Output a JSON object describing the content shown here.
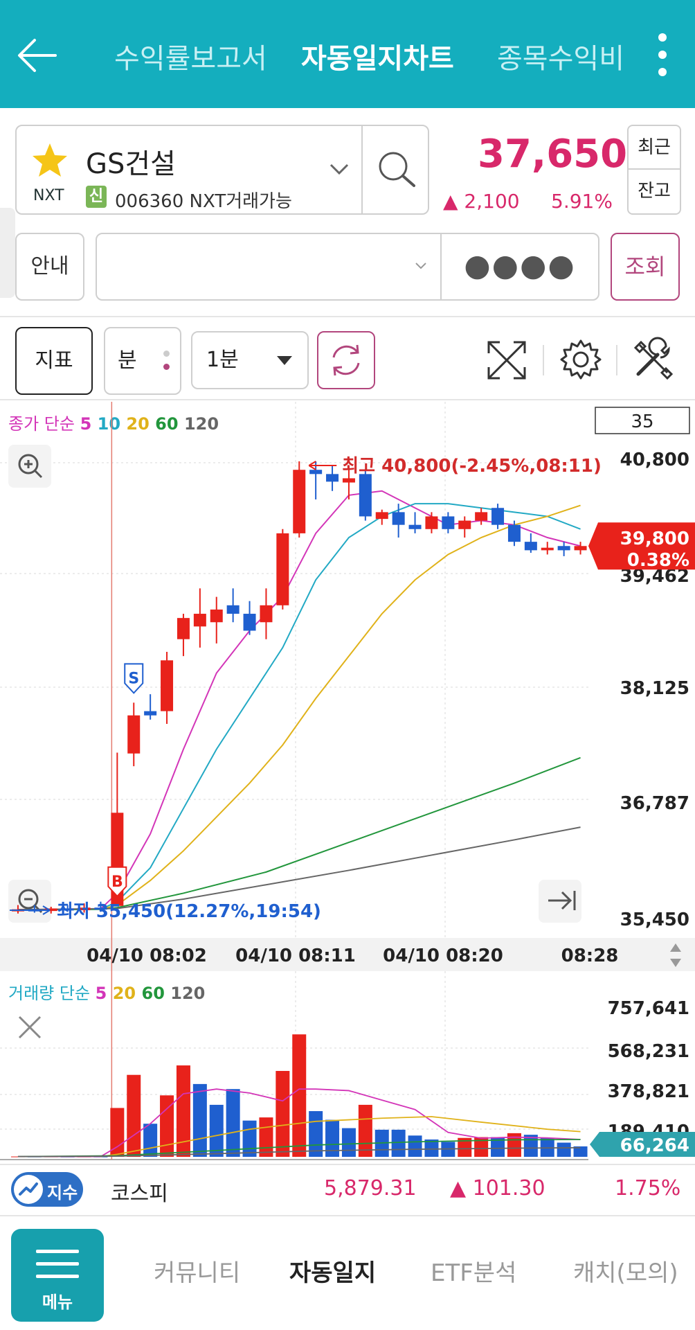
{
  "header": {
    "tabs": [
      {
        "label": "수익률보고서",
        "active": false
      },
      {
        "label": "자동일지차트",
        "active": true
      },
      {
        "label": "종목수익비"
      }
    ]
  },
  "stock": {
    "market": "NXT",
    "name": "GS건설",
    "credit_badge": "신",
    "code_info": "006360 NXT거래가능",
    "price": "37,650",
    "change": "▲ 2,100",
    "rate": "5.91%",
    "side_buttons": [
      "최근",
      "잔고"
    ]
  },
  "account": {
    "info_label": "안내",
    "password_mask": "●●●●",
    "query_label": "조회"
  },
  "toolbar": {
    "indicator_label": "지표",
    "period_label": "분",
    "interval_value": "1분"
  },
  "colors": {
    "accent": "#14aebe",
    "up": "#e8221b",
    "down": "#1f5fcf",
    "ma5": "#d335b8",
    "ma10": "#22a9c4",
    "ma20": "#e0b21a",
    "ma60": "#22963c",
    "ma120": "#666666"
  },
  "chart_data": [
    {
      "type": "candlestick",
      "legend": {
        "prefix": "종가 단순",
        "periods": [
          "5",
          "10",
          "20",
          "60",
          "120"
        ]
      },
      "count_box": "35",
      "y_ticks": [
        "40,800",
        "39,462",
        "38,125",
        "36,787",
        "35,450"
      ],
      "ylim": [
        35450,
        40800
      ],
      "x_ticks": [
        "04/10 08:02",
        "04/10 08:11",
        "04/10 08:20",
        "08:28"
      ],
      "high_label": "최고 40,800(-2.45%,08:11)",
      "low_label": "최저 35,450(12.27%,19:54)",
      "current_price": "39,800",
      "current_rate": "0.38%",
      "markers": [
        {
          "label": "B",
          "index": 6
        },
        {
          "label": "S",
          "index": 7
        }
      ],
      "candles": [
        {
          "o": 35500,
          "h": 35560,
          "l": 35460,
          "c": 35510
        },
        {
          "o": 35510,
          "h": 35560,
          "l": 35470,
          "c": 35490
        },
        {
          "o": 35490,
          "h": 35540,
          "l": 35460,
          "c": 35520
        },
        {
          "o": 35520,
          "h": 35560,
          "l": 35480,
          "c": 35500
        },
        {
          "o": 35500,
          "h": 35580,
          "l": 35470,
          "c": 35530
        },
        {
          "o": 35530,
          "h": 35600,
          "l": 35480,
          "c": 35520
        },
        {
          "o": 35550,
          "h": 37360,
          "l": 35600,
          "c": 36650
        },
        {
          "o": 37350,
          "h": 37950,
          "l": 37200,
          "c": 37800
        },
        {
          "o": 37850,
          "h": 38050,
          "l": 37750,
          "c": 37800
        },
        {
          "o": 37850,
          "h": 38550,
          "l": 37700,
          "c": 38450
        },
        {
          "o": 38700,
          "h": 39000,
          "l": 38500,
          "c": 38950
        },
        {
          "o": 38850,
          "h": 39300,
          "l": 38600,
          "c": 39000
        },
        {
          "o": 38900,
          "h": 39200,
          "l": 38650,
          "c": 39050
        },
        {
          "o": 39100,
          "h": 39300,
          "l": 38900,
          "c": 39000
        },
        {
          "o": 39000,
          "h": 39150,
          "l": 38750,
          "c": 38800
        },
        {
          "o": 38900,
          "h": 39300,
          "l": 38700,
          "c": 39100
        },
        {
          "o": 39100,
          "h": 40000,
          "l": 39050,
          "c": 39950
        },
        {
          "o": 39950,
          "h": 40800,
          "l": 39900,
          "c": 40700
        },
        {
          "o": 40700,
          "h": 40800,
          "l": 40350,
          "c": 40650
        },
        {
          "o": 40650,
          "h": 40750,
          "l": 40450,
          "c": 40560
        },
        {
          "o": 40550,
          "h": 40750,
          "l": 40350,
          "c": 40600
        },
        {
          "o": 40650,
          "h": 40700,
          "l": 40100,
          "c": 40150
        },
        {
          "o": 40120,
          "h": 40230,
          "l": 40050,
          "c": 40200
        },
        {
          "o": 40200,
          "h": 40300,
          "l": 39900,
          "c": 40050
        },
        {
          "o": 40050,
          "h": 40200,
          "l": 39950,
          "c": 40000
        },
        {
          "o": 40000,
          "h": 40200,
          "l": 39950,
          "c": 40150
        },
        {
          "o": 40150,
          "h": 40200,
          "l": 39950,
          "c": 40000
        },
        {
          "o": 40000,
          "h": 40150,
          "l": 39900,
          "c": 40100
        },
        {
          "o": 40100,
          "h": 40250,
          "l": 40050,
          "c": 40200
        },
        {
          "o": 40250,
          "h": 40300,
          "l": 40000,
          "c": 40050
        },
        {
          "o": 40050,
          "h": 40100,
          "l": 39800,
          "c": 39850
        },
        {
          "o": 39850,
          "h": 39950,
          "l": 39720,
          "c": 39750
        },
        {
          "o": 39750,
          "h": 39850,
          "l": 39700,
          "c": 39780
        },
        {
          "o": 39800,
          "h": 39850,
          "l": 39680,
          "c": 39750
        },
        {
          "o": 39750,
          "h": 39850,
          "l": 39700,
          "c": 39800
        }
      ],
      "ma_lines": [
        {
          "period": "5",
          "color": "#d335b8",
          "points": [
            [
              0,
              35505
            ],
            [
              5,
              35515
            ],
            [
              6,
              35700
            ],
            [
              8,
              36400
            ],
            [
              10,
              37400
            ],
            [
              12,
              38300
            ],
            [
              14,
              38800
            ],
            [
              16,
              39200
            ],
            [
              18,
              39950
            ],
            [
              20,
              40400
            ],
            [
              22,
              40450
            ],
            [
              24,
              40250
            ],
            [
              26,
              40050
            ],
            [
              28,
              40100
            ],
            [
              30,
              40050
            ],
            [
              32,
              39900
            ],
            [
              34,
              39800
            ]
          ]
        },
        {
          "period": "10",
          "color": "#22a9c4",
          "points": [
            [
              0,
              35505
            ],
            [
              5,
              35510
            ],
            [
              6,
              35600
            ],
            [
              8,
              36000
            ],
            [
              10,
              36700
            ],
            [
              12,
              37400
            ],
            [
              14,
              38000
            ],
            [
              16,
              38600
            ],
            [
              18,
              39400
            ],
            [
              20,
              39900
            ],
            [
              22,
              40150
            ],
            [
              24,
              40300
            ],
            [
              26,
              40300
            ],
            [
              28,
              40250
            ],
            [
              30,
              40200
            ],
            [
              32,
              40150
            ],
            [
              34,
              40000
            ]
          ]
        },
        {
          "period": "20",
          "color": "#e0b21a",
          "points": [
            [
              5,
              35510
            ],
            [
              6,
              35560
            ],
            [
              8,
              35850
            ],
            [
              10,
              36200
            ],
            [
              12,
              36600
            ],
            [
              14,
              37000
            ],
            [
              16,
              37450
            ],
            [
              18,
              38000
            ],
            [
              20,
              38500
            ],
            [
              22,
              39000
            ],
            [
              24,
              39400
            ],
            [
              26,
              39700
            ],
            [
              28,
              39900
            ],
            [
              30,
              40050
            ],
            [
              32,
              40150
            ],
            [
              34,
              40280
            ]
          ]
        },
        {
          "period": "60",
          "color": "#22963c",
          "points": [
            [
              0,
              35505
            ],
            [
              5,
              35510
            ],
            [
              6,
              35530
            ],
            [
              10,
              35700
            ],
            [
              15,
              35950
            ],
            [
              20,
              36300
            ],
            [
              25,
              36650
            ],
            [
              30,
              37000
            ],
            [
              34,
              37300
            ]
          ]
        },
        {
          "period": "120",
          "color": "#666666",
          "points": [
            [
              0,
              35505
            ],
            [
              6,
              35520
            ],
            [
              10,
              35630
            ],
            [
              15,
              35800
            ],
            [
              20,
              35970
            ],
            [
              25,
              36150
            ],
            [
              30,
              36330
            ],
            [
              34,
              36480
            ]
          ]
        }
      ]
    },
    {
      "type": "bar",
      "legend": {
        "prefix": "거래량 단순",
        "periods": [
          "5",
          "20",
          "60",
          "120"
        ]
      },
      "y_ticks": [
        "757,641",
        "568,231",
        "378,821",
        "189,410"
      ],
      "ylim": [
        0,
        800000
      ],
      "current_volume": "66,264",
      "bars": [
        {
          "v": 2000,
          "up": true
        },
        {
          "v": 1500,
          "up": false
        },
        {
          "v": 1800,
          "up": true
        },
        {
          "v": 1200,
          "up": false
        },
        {
          "v": 1600,
          "up": true
        },
        {
          "v": 1400,
          "up": false
        },
        {
          "v": 310000,
          "up": true
        },
        {
          "v": 520000,
          "up": true
        },
        {
          "v": 210000,
          "up": false
        },
        {
          "v": 390000,
          "up": true
        },
        {
          "v": 580000,
          "up": true
        },
        {
          "v": 462000,
          "up": false
        },
        {
          "v": 330000,
          "up": false
        },
        {
          "v": 430000,
          "up": false
        },
        {
          "v": 230000,
          "up": false
        },
        {
          "v": 250000,
          "up": true
        },
        {
          "v": 545000,
          "up": true
        },
        {
          "v": 777000,
          "up": true
        },
        {
          "v": 290000,
          "up": false
        },
        {
          "v": 235000,
          "up": false
        },
        {
          "v": 182000,
          "up": false
        },
        {
          "v": 330000,
          "up": true
        },
        {
          "v": 172000,
          "up": false
        },
        {
          "v": 172000,
          "up": false
        },
        {
          "v": 135000,
          "up": false
        },
        {
          "v": 110000,
          "up": false
        },
        {
          "v": 95000,
          "up": false
        },
        {
          "v": 120000,
          "up": true
        },
        {
          "v": 125000,
          "up": true
        },
        {
          "v": 125000,
          "up": false
        },
        {
          "v": 150000,
          "up": true
        },
        {
          "v": 140000,
          "up": false
        },
        {
          "v": 120000,
          "up": false
        },
        {
          "v": 90000,
          "up": false
        },
        {
          "v": 66264,
          "up": false
        }
      ],
      "ma_lines": [
        {
          "period": "5",
          "color": "#d335b8",
          "points": [
            [
              0,
              1600
            ],
            [
              5,
              1600
            ],
            [
              6,
              64000
            ],
            [
              8,
              210000
            ],
            [
              10,
              400000
            ],
            [
              12,
              430000
            ],
            [
              14,
              405000
            ],
            [
              16,
              355000
            ],
            [
              17,
              430000
            ],
            [
              18,
              430000
            ],
            [
              20,
              420000
            ],
            [
              22,
              360000
            ],
            [
              24,
              300000
            ],
            [
              26,
              155000
            ],
            [
              28,
              118000
            ],
            [
              30,
              125000
            ],
            [
              32,
              120000
            ],
            [
              34,
              110000
            ]
          ]
        },
        {
          "period": "20",
          "color": "#e0b21a",
          "points": [
            [
              5,
              1600
            ],
            [
              6,
              16000
            ],
            [
              10,
              95000
            ],
            [
              14,
              175000
            ],
            [
              18,
              225000
            ],
            [
              22,
              245000
            ],
            [
              25,
              255000
            ],
            [
              28,
              220000
            ],
            [
              32,
              175000
            ],
            [
              34,
              160000
            ]
          ]
        },
        {
          "period": "60",
          "color": "#22963c",
          "points": [
            [
              0,
              1500
            ],
            [
              6,
              7000
            ],
            [
              12,
              40000
            ],
            [
              18,
              75000
            ],
            [
              24,
              95000
            ],
            [
              30,
              108000
            ],
            [
              34,
              110000
            ]
          ]
        },
        {
          "period": "120",
          "color": "#666666",
          "points": [
            [
              0,
              1500
            ],
            [
              6,
              4000
            ],
            [
              12,
              20000
            ],
            [
              18,
              38000
            ],
            [
              24,
              48000
            ],
            [
              30,
              55000
            ],
            [
              34,
              58000
            ]
          ]
        }
      ]
    }
  ],
  "index_bar": {
    "badge_label": "지수",
    "name": "코스피",
    "value": "5,879.31",
    "change": "▲ 101.30",
    "rate": "1.75%"
  },
  "bottom_nav": {
    "menu_label": "메뉴",
    "tabs": [
      {
        "label": "커뮤니티",
        "active": false
      },
      {
        "label": "자동일지",
        "active": true
      },
      {
        "label": "ETF분석",
        "active": false
      },
      {
        "label": "캐치(모의)",
        "active": false
      }
    ]
  }
}
